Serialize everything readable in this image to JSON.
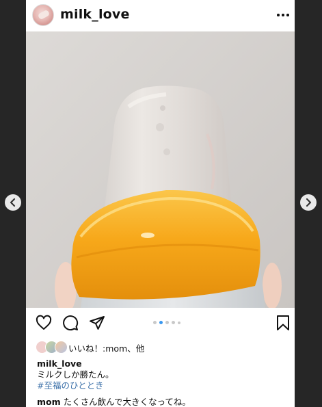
{
  "post": {
    "username": "milk_love",
    "carousel": {
      "dot_count": 5,
      "active_index": 1
    },
    "likes": {
      "text": "いいね！:mom、他"
    },
    "caption": {
      "username": "milk_love",
      "text": "ミルクしか勝たん。",
      "hashtag": "#至福のひととき"
    },
    "comment": {
      "username": "mom",
      "text": "たくさん飲んで大きくなってね。"
    }
  },
  "icons": {
    "more": "more-options-icon",
    "like": "heart-icon",
    "comment": "comment-icon",
    "share": "paper-plane-icon",
    "save": "bookmark-icon",
    "prev": "chevron-left-icon",
    "next": "chevron-right-icon"
  },
  "colors": {
    "background": "#262626",
    "card": "#ffffff",
    "hashtag": "#3a6fa8",
    "active_dot": "#3897f0",
    "inactive_dot": "#c9c9c9",
    "bottle_cap": "#f7a81a"
  }
}
